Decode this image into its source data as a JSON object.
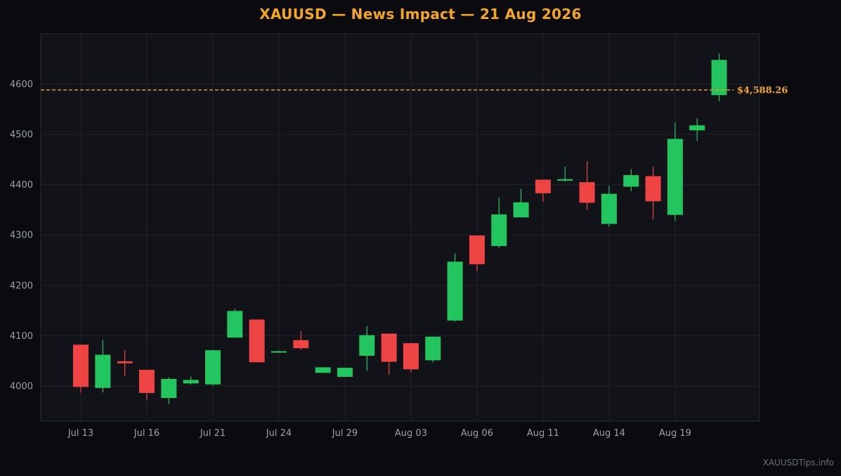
{
  "chart_data": {
    "type": "candlestick",
    "title": "XAUUSD — News Impact — 21 Aug 2026",
    "xlabel": "",
    "ylabel": "",
    "ylim": [
      3930,
      4700
    ],
    "yticks": [
      4000,
      4100,
      4200,
      4300,
      4400,
      4500,
      4600
    ],
    "grid": true,
    "xtick_labels": [
      {
        "index": 0,
        "label": "Jul 13"
      },
      {
        "index": 3,
        "label": "Jul 16"
      },
      {
        "index": 6,
        "label": "Jul 21"
      },
      {
        "index": 9,
        "label": "Jul 24"
      },
      {
        "index": 12,
        "label": "Jul 29"
      },
      {
        "index": 15,
        "label": "Aug 03"
      },
      {
        "index": 18,
        "label": "Aug 06"
      },
      {
        "index": 21,
        "label": "Aug 11"
      },
      {
        "index": 24,
        "label": "Aug 14"
      },
      {
        "index": 27,
        "label": "Aug 19"
      }
    ],
    "candles": [
      {
        "open": 4082,
        "high": 4082,
        "low": 3987,
        "close": 3998
      },
      {
        "open": 3996,
        "high": 4092,
        "low": 3987,
        "close": 4062
      },
      {
        "open": 4049,
        "high": 4071,
        "low": 4020,
        "close": 4045
      },
      {
        "open": 4032,
        "high": 4032,
        "low": 3972,
        "close": 3986
      },
      {
        "open": 3976,
        "high": 4017,
        "low": 3964,
        "close": 4014
      },
      {
        "open": 4005,
        "high": 4019,
        "low": 4003,
        "close": 4012
      },
      {
        "open": 4003,
        "high": 4072,
        "low": 4001,
        "close": 4071
      },
      {
        "open": 4096,
        "high": 4153,
        "low": 4096,
        "close": 4149
      },
      {
        "open": 4132,
        "high": 4132,
        "low": 4047,
        "close": 4047
      },
      {
        "open": 4068,
        "high": 4070,
        "low": 4068,
        "close": 4069
      },
      {
        "open": 4091,
        "high": 4109,
        "low": 4072,
        "close": 4075
      },
      {
        "open": 4026,
        "high": 4037,
        "low": 4026,
        "close": 4037
      },
      {
        "open": 4018,
        "high": 4036,
        "low": 4018,
        "close": 4036
      },
      {
        "open": 4060,
        "high": 4119,
        "low": 4030,
        "close": 4101
      },
      {
        "open": 4104,
        "high": 4104,
        "low": 4022,
        "close": 4048
      },
      {
        "open": 4085,
        "high": 4085,
        "low": 4027,
        "close": 4033
      },
      {
        "open": 4051,
        "high": 4098,
        "low": 4047,
        "close": 4098
      },
      {
        "open": 4130,
        "high": 4263,
        "low": 4128,
        "close": 4247
      },
      {
        "open": 4299,
        "high": 4299,
        "low": 4228,
        "close": 4242
      },
      {
        "open": 4278,
        "high": 4374,
        "low": 4274,
        "close": 4341
      },
      {
        "open": 4335,
        "high": 4392,
        "low": 4335,
        "close": 4365
      },
      {
        "open": 4410,
        "high": 4410,
        "low": 4366,
        "close": 4383
      },
      {
        "open": 4408,
        "high": 4436,
        "low": 4406,
        "close": 4411
      },
      {
        "open": 4405,
        "high": 4447,
        "low": 4350,
        "close": 4364
      },
      {
        "open": 4322,
        "high": 4398,
        "low": 4316,
        "close": 4382
      },
      {
        "open": 4396,
        "high": 4431,
        "low": 4387,
        "close": 4419
      },
      {
        "open": 4417,
        "high": 4436,
        "low": 4331,
        "close": 4367
      },
      {
        "open": 4340,
        "high": 4524,
        "low": 4328,
        "close": 4491
      },
      {
        "open": 4508,
        "high": 4532,
        "low": 4487,
        "close": 4518
      },
      {
        "open": 4578,
        "high": 4661,
        "low": 4566,
        "close": 4648
      }
    ],
    "reference_line": {
      "value": 4588.26,
      "label": "$4,588.26"
    },
    "colors": {
      "up": "#22c55e",
      "down": "#ef4444",
      "accent": "#f5a623",
      "background": "#0b0b0f",
      "plot_background": "#121318",
      "grid": "#20222a",
      "axis_text": "#9aa0aa"
    }
  },
  "watermark": "XAUUSDTips.info"
}
